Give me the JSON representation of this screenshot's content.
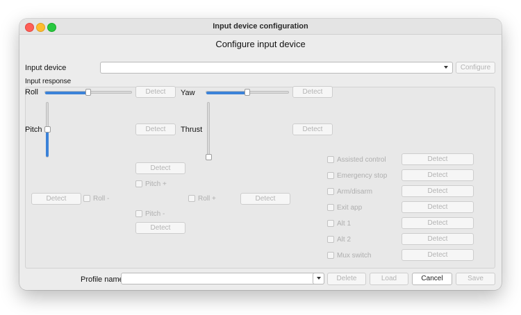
{
  "window": {
    "title": "Input device configuration"
  },
  "heading": "Configure input device",
  "input_device": {
    "label": "Input device",
    "value": "",
    "configure_label": "Configure"
  },
  "input_response": {
    "label": "Input response",
    "roll": {
      "label": "Roll",
      "level": 0.5,
      "detect_label": "Detect"
    },
    "yaw": {
      "label": "Yaw",
      "level": 0.5,
      "detect_label": "Detect"
    },
    "pitch": {
      "label": "Pitch",
      "level": 0.5,
      "detect_label": "Detect"
    },
    "thrust": {
      "label": "Thrust",
      "level": 0.0,
      "detect_label": "Detect"
    },
    "pitch_plus": {
      "label": "Pitch +",
      "detect_label": "Detect"
    },
    "pitch_minus": {
      "label": "Pitch -",
      "detect_label": "Detect"
    },
    "roll_minus": {
      "label": "Roll -",
      "detect_label": "Detect"
    },
    "roll_plus": {
      "label": "Roll +",
      "detect_label": "Detect"
    }
  },
  "actions": [
    {
      "label": "Assisted control",
      "detect_label": "Detect"
    },
    {
      "label": "Emergency stop",
      "detect_label": "Detect"
    },
    {
      "label": "Arm/disarm",
      "detect_label": "Detect"
    },
    {
      "label": "Exit app",
      "detect_label": "Detect"
    },
    {
      "label": "Alt 1",
      "detect_label": "Detect"
    },
    {
      "label": "Alt 2",
      "detect_label": "Detect"
    },
    {
      "label": "Mux switch",
      "detect_label": "Detect"
    }
  ],
  "footer": {
    "profile_label": "Profile name",
    "profile_value": "",
    "delete_label": "Delete",
    "load_label": "Load",
    "cancel_label": "Cancel",
    "save_label": "Save"
  },
  "colors": {
    "accent": "#3b82d8",
    "close": "#ff5f57",
    "minimize": "#febc2e",
    "maximize": "#28c840"
  }
}
